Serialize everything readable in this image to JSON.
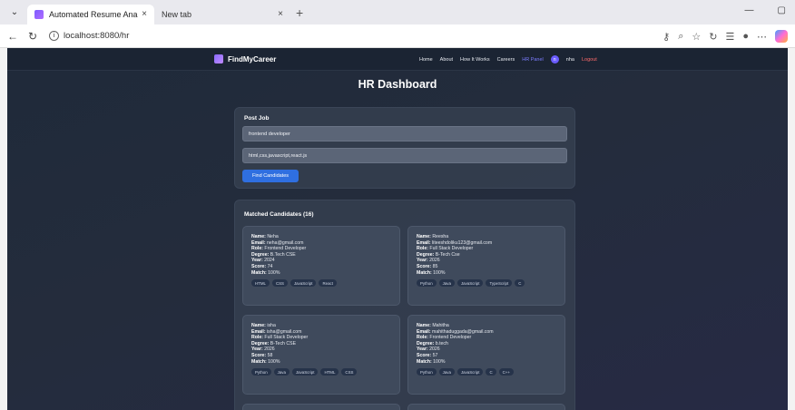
{
  "browser": {
    "tabs": [
      {
        "title": "Automated Resume Analysis & Sk",
        "close": "×"
      },
      {
        "title": "New tab",
        "close": "×"
      }
    ],
    "new_tab": "+",
    "url": "localhost:8080/hr",
    "window_controls": {
      "minimize": "—",
      "maximize": "▢"
    }
  },
  "app": {
    "brand": "FindMyCareer",
    "nav": {
      "home": "Home",
      "about": "About",
      "how": "How It Works",
      "careers": "Careers",
      "hr_panel": "HR Panel",
      "avatar_initial": "n",
      "user": "nha",
      "logout": "Logout"
    },
    "page_title": "HR Dashboard",
    "post_job": {
      "title": "Post Job",
      "job_title_value": "frontend developer",
      "skills_value": "html,css,javascript,react.js",
      "find_button": "Find Candidates"
    },
    "matched": {
      "title": "Matched Candidates (16)",
      "labels": {
        "name": "Name:",
        "email": "Email:",
        "role": "Role:",
        "degree": "Degree:",
        "year": "Year:",
        "score": "Score:",
        "match": "Match:"
      },
      "candidates": [
        {
          "name": "Neha",
          "email": "neha@gmail.com",
          "role": "Frontend Developer",
          "degree": "B.Tech CSE",
          "year": "2024",
          "score": "74",
          "match": "100%",
          "skills": [
            "HTML",
            "CSS",
            "JavaScript",
            "React"
          ]
        },
        {
          "name": "Reesha",
          "email": "liteeshdoliku123@gmail.com",
          "role": "Full Stack Developer",
          "degree": "B-Tech Cse",
          "year": "2026",
          "score": "85",
          "match": "100%",
          "skills": [
            "Python",
            "Java",
            "JavaScript",
            "TypeScript",
            "C"
          ]
        },
        {
          "name": "isha",
          "email": "isha@gmail.com",
          "role": "Full Stack Developer",
          "degree": "B-Tech CSE",
          "year": "2026",
          "score": "58",
          "match": "100%",
          "skills": [
            "Python",
            "Java",
            "JavaScript",
            "HTML",
            "CSS"
          ]
        },
        {
          "name": "Mahitha",
          "email": "mahithaduggada@gmail.com",
          "role": "Frontend Developer",
          "degree": "b.tech",
          "year": "2026",
          "score": "57",
          "match": "100%",
          "skills": [
            "Python",
            "Java",
            "JavaScript",
            "C",
            "C++"
          ]
        }
      ]
    }
  }
}
